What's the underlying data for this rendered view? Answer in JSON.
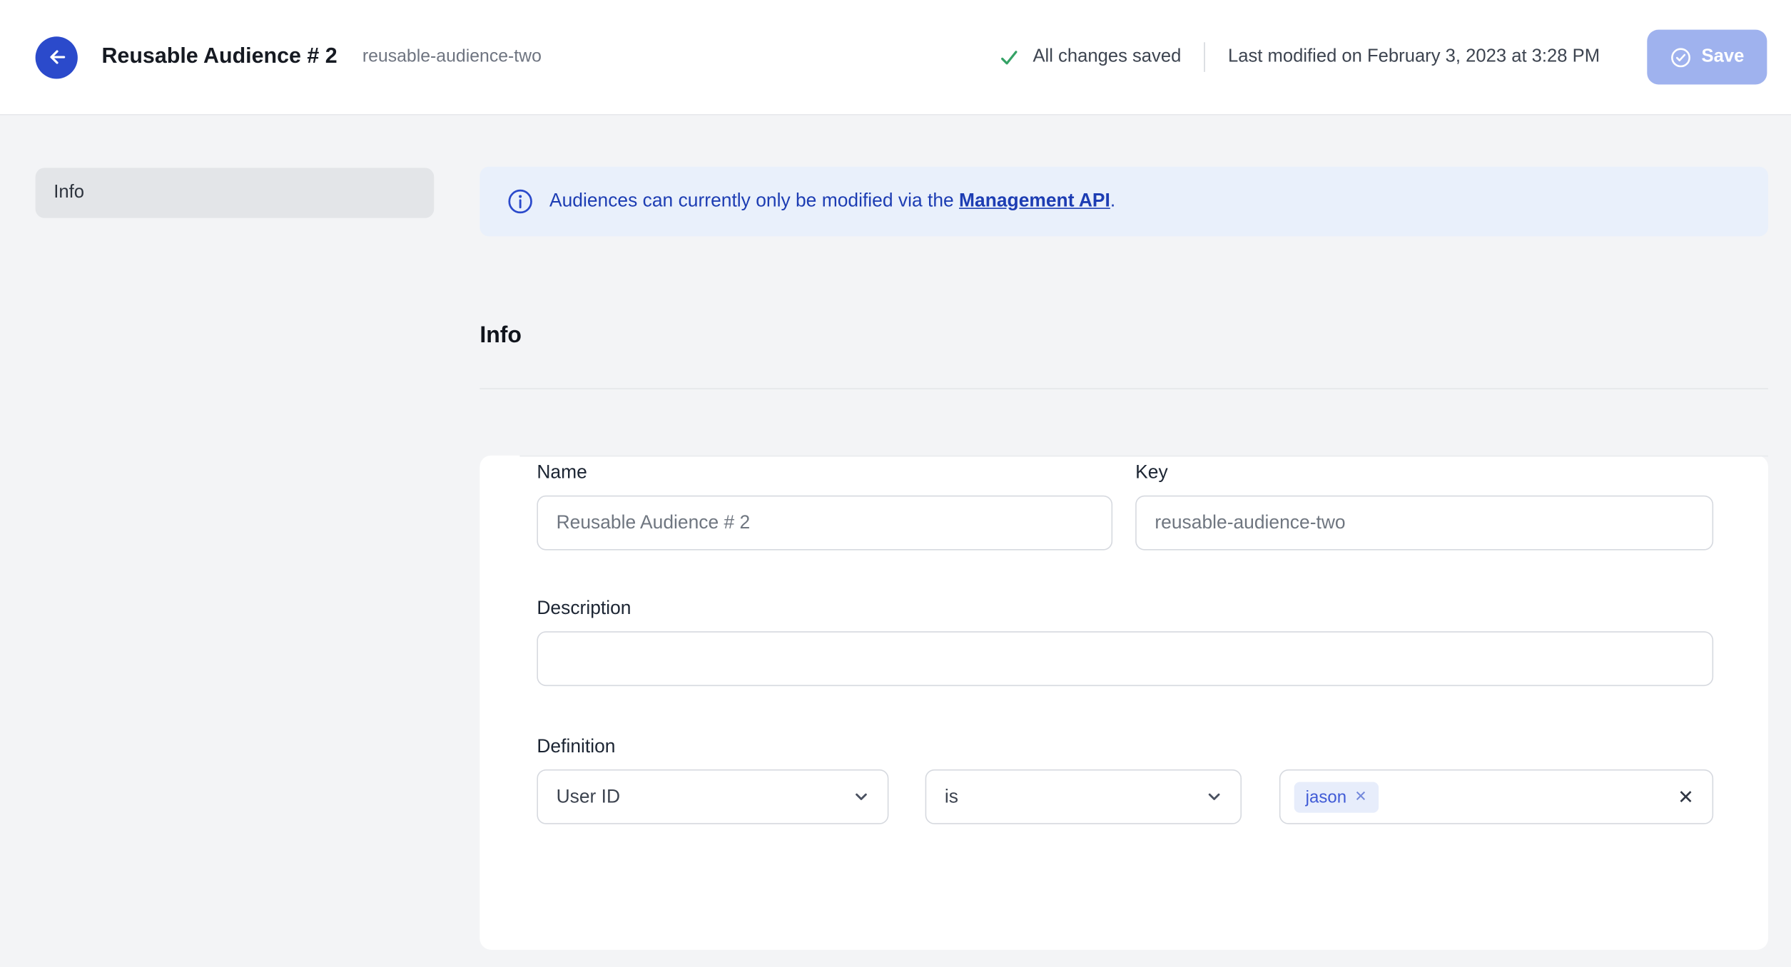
{
  "header": {
    "title": "Reusable Audience # 2",
    "subtitle": "reusable-audience-two",
    "status_text": "All changes saved",
    "modified_text": "Last modified on February 3, 2023 at 3:28 PM",
    "save_label": "Save"
  },
  "sidebar": {
    "items": [
      {
        "label": "Info",
        "selected": true
      }
    ]
  },
  "banner": {
    "text_prefix": "Audiences can currently only be modified via the ",
    "link_text": "Management API",
    "text_suffix": "."
  },
  "section": {
    "title": "Info"
  },
  "form": {
    "name": {
      "label": "Name",
      "value": "Reusable Audience # 2"
    },
    "key": {
      "label": "Key",
      "value": "reusable-audience-two"
    },
    "description": {
      "label": "Description",
      "value": ""
    },
    "definition": {
      "label": "Definition",
      "property_select": "User ID",
      "operator_select": "is",
      "tags": [
        "jason"
      ]
    }
  },
  "icons": {
    "tag_remove": "✕",
    "clear": "✕"
  },
  "colors": {
    "accent_blue": "#2b4acb",
    "banner_bg": "#e9f0fb",
    "banner_text": "#1d3db3",
    "success_green": "#34a265",
    "save_button_bg": "#9fb2ee",
    "selected_item_bg": "#e3e5e8"
  }
}
